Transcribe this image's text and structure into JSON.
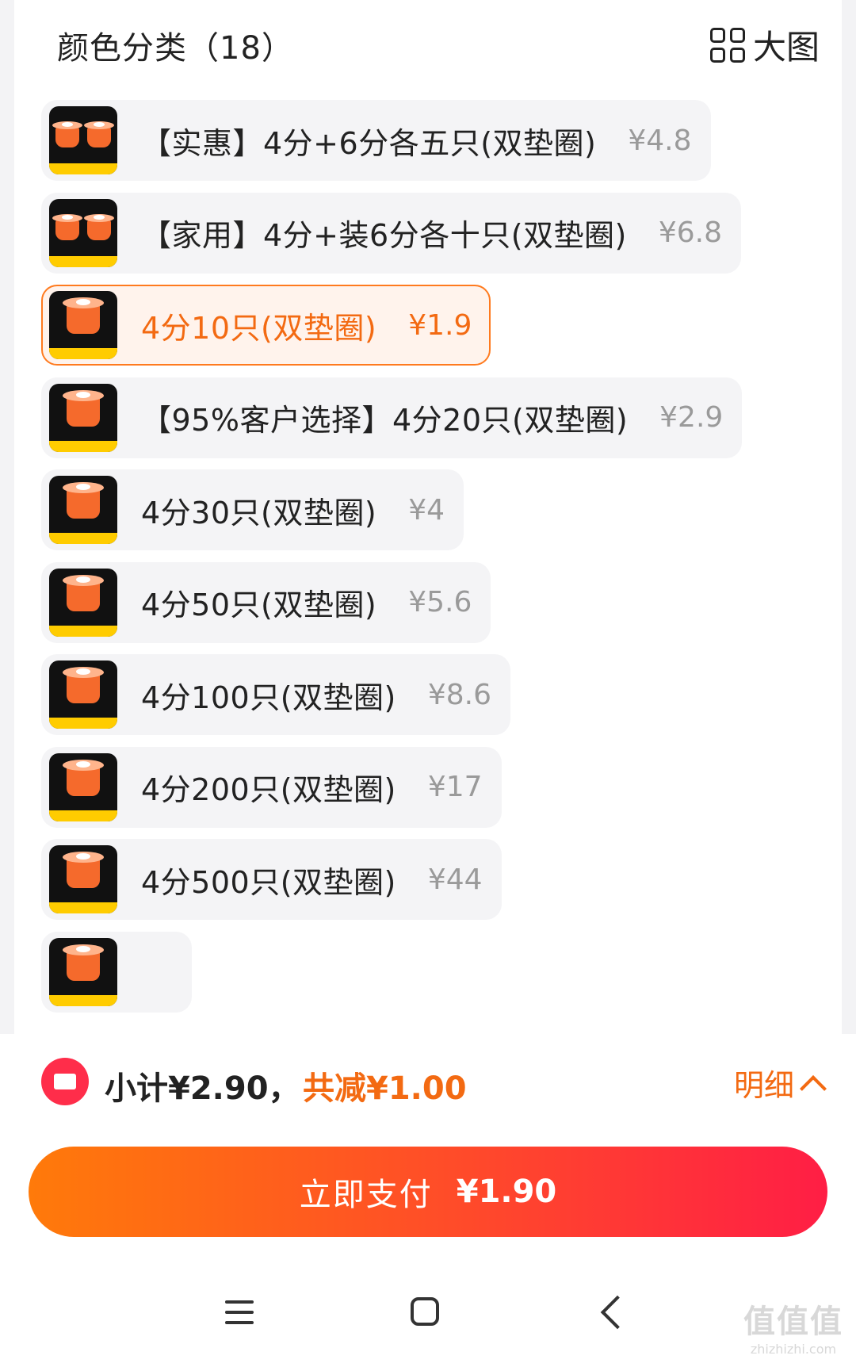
{
  "header": {
    "title": "颜色分类（18）",
    "view_toggle_label": "大图"
  },
  "options": [
    {
      "label": "【实惠】4分+6分各五只(双垫圈)",
      "price": "¥4.8",
      "thumb": "double"
    },
    {
      "label": "【家用】4分+装6分各十只(双垫圈)",
      "price": "¥6.8",
      "thumb": "double"
    },
    {
      "label": "4分10只(双垫圈)",
      "price": "¥1.9",
      "thumb": "single",
      "selected": true
    },
    {
      "label": "【95%客户选择】4分20只(双垫圈)",
      "price": "¥2.9",
      "thumb": "single"
    },
    {
      "label": "4分30只(双垫圈)",
      "price": "¥4",
      "thumb": "single"
    },
    {
      "label": "4分50只(双垫圈)",
      "price": "¥5.6",
      "thumb": "single"
    },
    {
      "label": "4分100只(双垫圈)",
      "price": "¥8.6",
      "thumb": "single"
    },
    {
      "label": "4分200只(双垫圈)",
      "price": "¥17",
      "thumb": "single"
    },
    {
      "label": "4分500只(双垫圈)",
      "price": "¥44",
      "thumb": "single"
    },
    {
      "label": "",
      "price": "",
      "thumb": "single"
    }
  ],
  "summary": {
    "subtotal": "小计¥2.90，",
    "discount": "共减¥1.00",
    "detail_label": "明细"
  },
  "pay_button": {
    "label": "立即支付",
    "amount": "¥1.90"
  },
  "watermark": {
    "mark": "值值值",
    "url": "zhizhizhi.com"
  },
  "colors": {
    "accent": "#f36a12",
    "pay_gradient_start": "#ff7a0a",
    "pay_gradient_end": "#ff1e45",
    "coupon": "#ff2d4a"
  },
  "icons": [
    "grid-icon",
    "coupon-icon",
    "chevron-up-icon",
    "menu-icon",
    "home-icon",
    "back-icon"
  ]
}
